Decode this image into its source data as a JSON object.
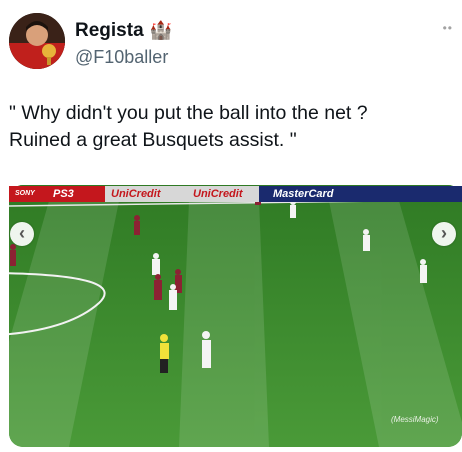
{
  "author": {
    "display_name": "Regista",
    "handle": "@F10baller",
    "badge_icon": "castle-icon"
  },
  "tweet": {
    "text": "\" Why didn't you put the ball into the net ?\nRuined a great Busquets assist. \""
  },
  "media": {
    "ads": [
      "SONY",
      "PS3",
      "UniCredit",
      "UniCredit",
      "MasterCard"
    ],
    "watermark": "(MessiMagic)",
    "pitch_color": "#3e8d2f"
  },
  "colors": {
    "text": "#0f1419",
    "secondary": "#536471"
  }
}
